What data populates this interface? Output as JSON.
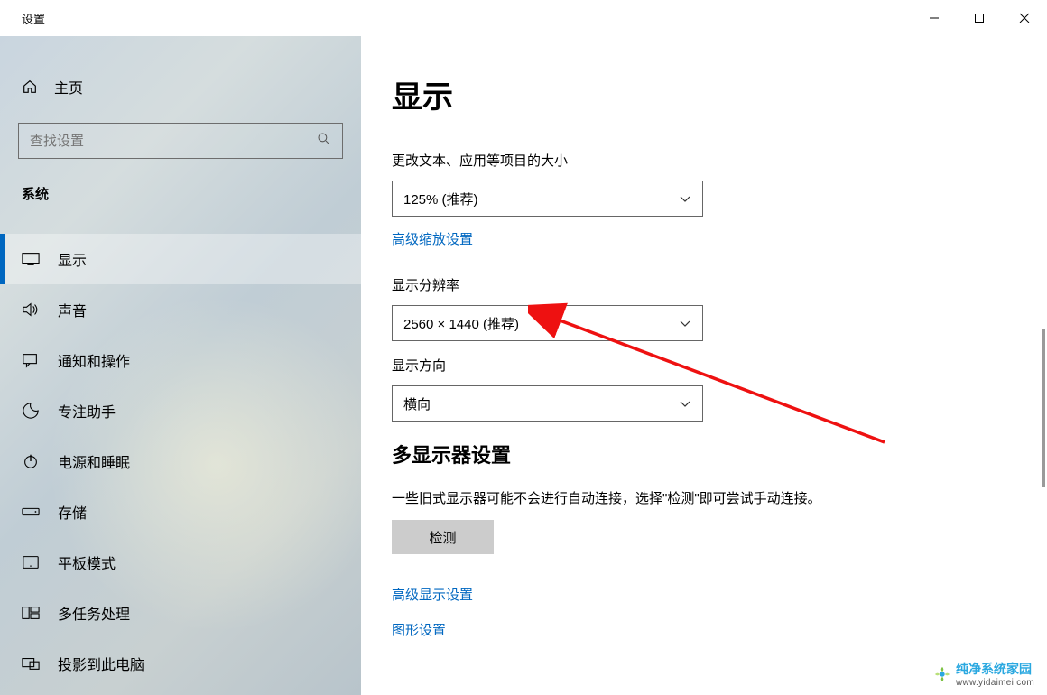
{
  "titlebar": {
    "title": "设置"
  },
  "sidebar": {
    "home": "主页",
    "search_placeholder": "查找设置",
    "category": "系统",
    "items": [
      {
        "icon": "display",
        "label": "显示",
        "active": true
      },
      {
        "icon": "sound",
        "label": "声音"
      },
      {
        "icon": "notifications",
        "label": "通知和操作"
      },
      {
        "icon": "focus",
        "label": "专注助手"
      },
      {
        "icon": "power",
        "label": "电源和睡眠"
      },
      {
        "icon": "storage",
        "label": "存储"
      },
      {
        "icon": "tablet",
        "label": "平板模式"
      },
      {
        "icon": "multitask",
        "label": "多任务处理"
      },
      {
        "icon": "project",
        "label": "投影到此电脑"
      }
    ]
  },
  "content": {
    "page_title": "显示",
    "scale_label": "更改文本、应用等项目的大小",
    "scale_value": "125% (推荐)",
    "advanced_scaling_link": "高级缩放设置",
    "resolution_label": "显示分辨率",
    "resolution_value": "2560 × 1440 (推荐)",
    "orientation_label": "显示方向",
    "orientation_value": "横向",
    "multi_display_title": "多显示器设置",
    "multi_display_desc": "一些旧式显示器可能不会进行自动连接，选择\"检测\"即可尝试手动连接。",
    "detect_button": "检测",
    "advanced_display_link": "高级显示设置",
    "graphics_link": "图形设置"
  },
  "watermark": {
    "brand": "纯净系统家园",
    "url": "www.yidaimei.com"
  }
}
